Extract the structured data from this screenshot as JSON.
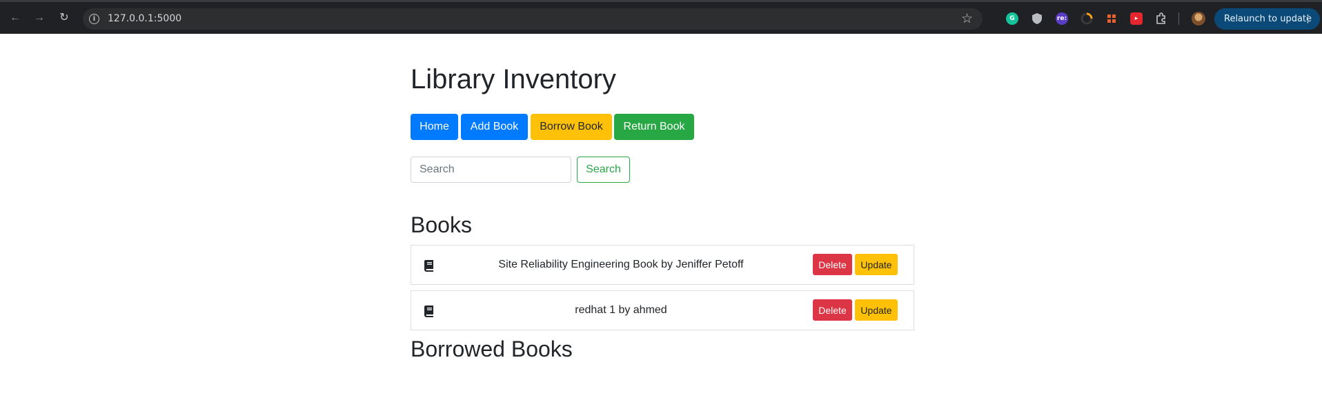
{
  "browser": {
    "url": "127.0.0.1:5000",
    "relaunch_label": "Relaunch to update",
    "extensions": [
      "grammarly-icon",
      "shield-extension-icon",
      "re-extension-icon",
      "loader-extension-icon",
      "grid-extension-icon",
      "red-extension-icon",
      "puzzle-icon"
    ],
    "extension_text": {
      "re": "re:"
    }
  },
  "header": {
    "title": "Library Inventory"
  },
  "nav": {
    "home": "Home",
    "add_book": "Add Book",
    "borrow_book": "Borrow Book",
    "return_book": "Return Book"
  },
  "search": {
    "placeholder": "Search",
    "button": "Search"
  },
  "books": {
    "heading": "Books",
    "items": [
      {
        "text": "Site Reliability Engineering Book by Jeniffer Petoff",
        "delete": "Delete",
        "update": "Update"
      },
      {
        "text": "redhat 1 by ahmed",
        "delete": "Delete",
        "update": "Update"
      }
    ]
  },
  "borrowed": {
    "heading": "Borrowed Books"
  },
  "colors": {
    "primary": "#007bff",
    "warning": "#ffc107",
    "success": "#28a745",
    "danger": "#dc3545",
    "chrome_bg": "#202124",
    "relaunch_bg": "#0b4a78"
  }
}
